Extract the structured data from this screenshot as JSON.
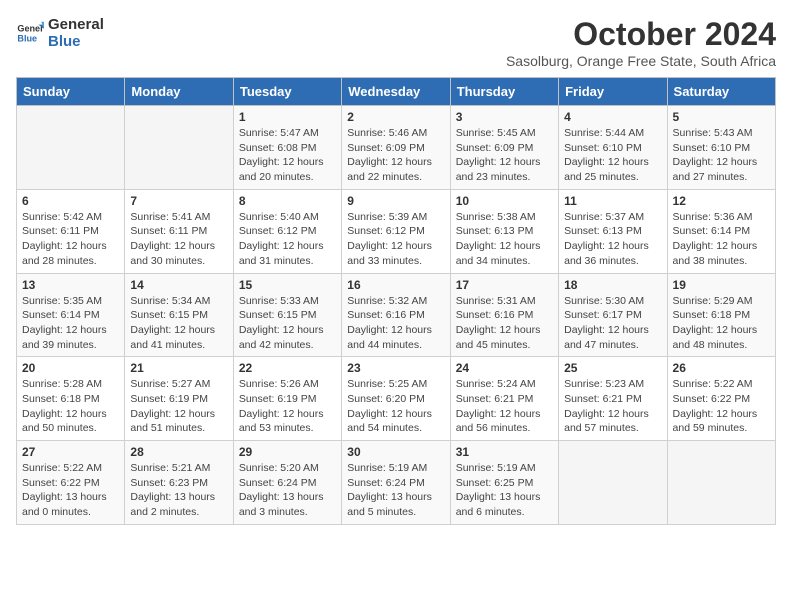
{
  "logo": {
    "line1": "General",
    "line2": "Blue"
  },
  "title": "October 2024",
  "subtitle": "Sasolburg, Orange Free State, South Africa",
  "days_of_week": [
    "Sunday",
    "Monday",
    "Tuesday",
    "Wednesday",
    "Thursday",
    "Friday",
    "Saturday"
  ],
  "weeks": [
    [
      {
        "day": "",
        "info": ""
      },
      {
        "day": "",
        "info": ""
      },
      {
        "day": "1",
        "info": "Sunrise: 5:47 AM\nSunset: 6:08 PM\nDaylight: 12 hours and 20 minutes."
      },
      {
        "day": "2",
        "info": "Sunrise: 5:46 AM\nSunset: 6:09 PM\nDaylight: 12 hours and 22 minutes."
      },
      {
        "day": "3",
        "info": "Sunrise: 5:45 AM\nSunset: 6:09 PM\nDaylight: 12 hours and 23 minutes."
      },
      {
        "day": "4",
        "info": "Sunrise: 5:44 AM\nSunset: 6:10 PM\nDaylight: 12 hours and 25 minutes."
      },
      {
        "day": "5",
        "info": "Sunrise: 5:43 AM\nSunset: 6:10 PM\nDaylight: 12 hours and 27 minutes."
      }
    ],
    [
      {
        "day": "6",
        "info": "Sunrise: 5:42 AM\nSunset: 6:11 PM\nDaylight: 12 hours and 28 minutes."
      },
      {
        "day": "7",
        "info": "Sunrise: 5:41 AM\nSunset: 6:11 PM\nDaylight: 12 hours and 30 minutes."
      },
      {
        "day": "8",
        "info": "Sunrise: 5:40 AM\nSunset: 6:12 PM\nDaylight: 12 hours and 31 minutes."
      },
      {
        "day": "9",
        "info": "Sunrise: 5:39 AM\nSunset: 6:12 PM\nDaylight: 12 hours and 33 minutes."
      },
      {
        "day": "10",
        "info": "Sunrise: 5:38 AM\nSunset: 6:13 PM\nDaylight: 12 hours and 34 minutes."
      },
      {
        "day": "11",
        "info": "Sunrise: 5:37 AM\nSunset: 6:13 PM\nDaylight: 12 hours and 36 minutes."
      },
      {
        "day": "12",
        "info": "Sunrise: 5:36 AM\nSunset: 6:14 PM\nDaylight: 12 hours and 38 minutes."
      }
    ],
    [
      {
        "day": "13",
        "info": "Sunrise: 5:35 AM\nSunset: 6:14 PM\nDaylight: 12 hours and 39 minutes."
      },
      {
        "day": "14",
        "info": "Sunrise: 5:34 AM\nSunset: 6:15 PM\nDaylight: 12 hours and 41 minutes."
      },
      {
        "day": "15",
        "info": "Sunrise: 5:33 AM\nSunset: 6:15 PM\nDaylight: 12 hours and 42 minutes."
      },
      {
        "day": "16",
        "info": "Sunrise: 5:32 AM\nSunset: 6:16 PM\nDaylight: 12 hours and 44 minutes."
      },
      {
        "day": "17",
        "info": "Sunrise: 5:31 AM\nSunset: 6:16 PM\nDaylight: 12 hours and 45 minutes."
      },
      {
        "day": "18",
        "info": "Sunrise: 5:30 AM\nSunset: 6:17 PM\nDaylight: 12 hours and 47 minutes."
      },
      {
        "day": "19",
        "info": "Sunrise: 5:29 AM\nSunset: 6:18 PM\nDaylight: 12 hours and 48 minutes."
      }
    ],
    [
      {
        "day": "20",
        "info": "Sunrise: 5:28 AM\nSunset: 6:18 PM\nDaylight: 12 hours and 50 minutes."
      },
      {
        "day": "21",
        "info": "Sunrise: 5:27 AM\nSunset: 6:19 PM\nDaylight: 12 hours and 51 minutes."
      },
      {
        "day": "22",
        "info": "Sunrise: 5:26 AM\nSunset: 6:19 PM\nDaylight: 12 hours and 53 minutes."
      },
      {
        "day": "23",
        "info": "Sunrise: 5:25 AM\nSunset: 6:20 PM\nDaylight: 12 hours and 54 minutes."
      },
      {
        "day": "24",
        "info": "Sunrise: 5:24 AM\nSunset: 6:21 PM\nDaylight: 12 hours and 56 minutes."
      },
      {
        "day": "25",
        "info": "Sunrise: 5:23 AM\nSunset: 6:21 PM\nDaylight: 12 hours and 57 minutes."
      },
      {
        "day": "26",
        "info": "Sunrise: 5:22 AM\nSunset: 6:22 PM\nDaylight: 12 hours and 59 minutes."
      }
    ],
    [
      {
        "day": "27",
        "info": "Sunrise: 5:22 AM\nSunset: 6:22 PM\nDaylight: 13 hours and 0 minutes."
      },
      {
        "day": "28",
        "info": "Sunrise: 5:21 AM\nSunset: 6:23 PM\nDaylight: 13 hours and 2 minutes."
      },
      {
        "day": "29",
        "info": "Sunrise: 5:20 AM\nSunset: 6:24 PM\nDaylight: 13 hours and 3 minutes."
      },
      {
        "day": "30",
        "info": "Sunrise: 5:19 AM\nSunset: 6:24 PM\nDaylight: 13 hours and 5 minutes."
      },
      {
        "day": "31",
        "info": "Sunrise: 5:19 AM\nSunset: 6:25 PM\nDaylight: 13 hours and 6 minutes."
      },
      {
        "day": "",
        "info": ""
      },
      {
        "day": "",
        "info": ""
      }
    ]
  ]
}
